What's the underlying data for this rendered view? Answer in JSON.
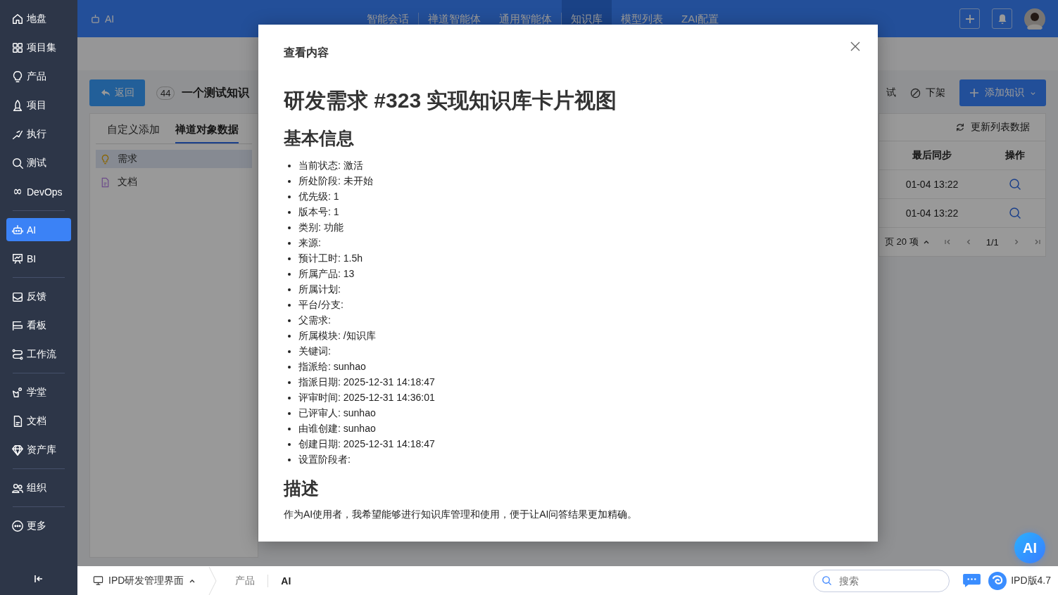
{
  "sidebar": {
    "groups": [
      {
        "items": [
          {
            "label": "地盘",
            "selected": false
          },
          {
            "label": "项目集",
            "selected": false
          },
          {
            "label": "产品",
            "selected": false
          },
          {
            "label": "项目",
            "selected": false
          },
          {
            "label": "执行",
            "selected": false
          },
          {
            "label": "测试",
            "selected": false
          },
          {
            "label": "DevOps",
            "selected": false
          }
        ]
      },
      {
        "items": [
          {
            "label": "AI",
            "selected": true
          },
          {
            "label": "BI",
            "selected": false
          }
        ]
      },
      {
        "items": [
          {
            "label": "反馈",
            "selected": false
          },
          {
            "label": "看板",
            "selected": false
          },
          {
            "label": "工作流",
            "selected": false
          }
        ]
      },
      {
        "items": [
          {
            "label": "学堂",
            "selected": false
          },
          {
            "label": "文档",
            "selected": false
          },
          {
            "label": "资产库",
            "selected": false
          }
        ]
      },
      {
        "items": [
          {
            "label": "组织",
            "selected": false
          }
        ]
      },
      {
        "items": [
          {
            "label": "更多",
            "selected": false
          }
        ]
      }
    ]
  },
  "top_bar": {
    "module": "AI",
    "nav": [
      {
        "label": "智能会话",
        "selected": false,
        "divider_after": true
      },
      {
        "label": "禅道智能体",
        "selected": false,
        "divider_after": false
      },
      {
        "label": "通用智能体",
        "selected": false,
        "divider_after": true
      },
      {
        "label": "知识库",
        "selected": true,
        "divider_after": false
      },
      {
        "label": "模型列表",
        "selected": false,
        "divider_after": false
      },
      {
        "label": "ZAI配置",
        "selected": false,
        "divider_after": false
      }
    ]
  },
  "page": {
    "back_button": "返回",
    "count": "44",
    "title": "一个测试知识",
    "actions": [
      {
        "label": "试",
        "kind": "text"
      },
      {
        "label": "下架",
        "kind": "offline"
      }
    ],
    "add_button": "添加知识",
    "tabs": [
      {
        "label": "自定义添加",
        "selected": false
      },
      {
        "label": "禅道对象数据",
        "selected": true
      }
    ],
    "object_types": [
      {
        "label": "需求",
        "kind": "story",
        "selected": true
      },
      {
        "label": "文档",
        "kind": "doc",
        "selected": false
      }
    ],
    "refresh": "更新列表数据",
    "table": {
      "columns": [
        "最后同步",
        "操作"
      ],
      "rows": [
        {
          "last_sync": "01-04 13:22"
        },
        {
          "last_sync": "01-04 13:22"
        }
      ]
    },
    "pagination": {
      "page_size": "页 20 项",
      "page": "1/1"
    }
  },
  "modal": {
    "title": "查看内容",
    "heading": "研发需求 #323 实现知识库卡片视图",
    "sections": [
      {
        "heading": "基本信息",
        "kind": "list",
        "items": [
          "当前状态: 激活",
          "所处阶段: 未开始",
          "优先级: 1",
          "版本号: 1",
          "类别: 功能",
          "来源:",
          "预计工时: 1.5h",
          "所属产品: 13",
          "所属计划:",
          "平台/分支:",
          "父需求:",
          "所属模块: /知识库",
          "关键词:",
          "指派给: sunhao",
          "指派日期: 2025-12-31 14:18:47",
          "评审时间: 2025-12-31 14:36:01",
          "已评审人: sunhao",
          "由谁创建: sunhao",
          "创建日期: 2025-12-31 14:18:47",
          "设置阶段者:"
        ]
      },
      {
        "heading": "描述",
        "kind": "text",
        "text": "作为AI使用者，我希望能够进行知识库管理和使用，便于让AI问答结果更加精确。"
      }
    ]
  },
  "ai_button": "AI",
  "bottom_bar": {
    "app": "IPD研发管理界面",
    "crumbs": [
      {
        "label": "产品",
        "selected": false
      },
      {
        "label": "AI",
        "selected": true
      }
    ],
    "search": {
      "placeholder": "搜索"
    },
    "version": "IPD版4.7"
  }
}
